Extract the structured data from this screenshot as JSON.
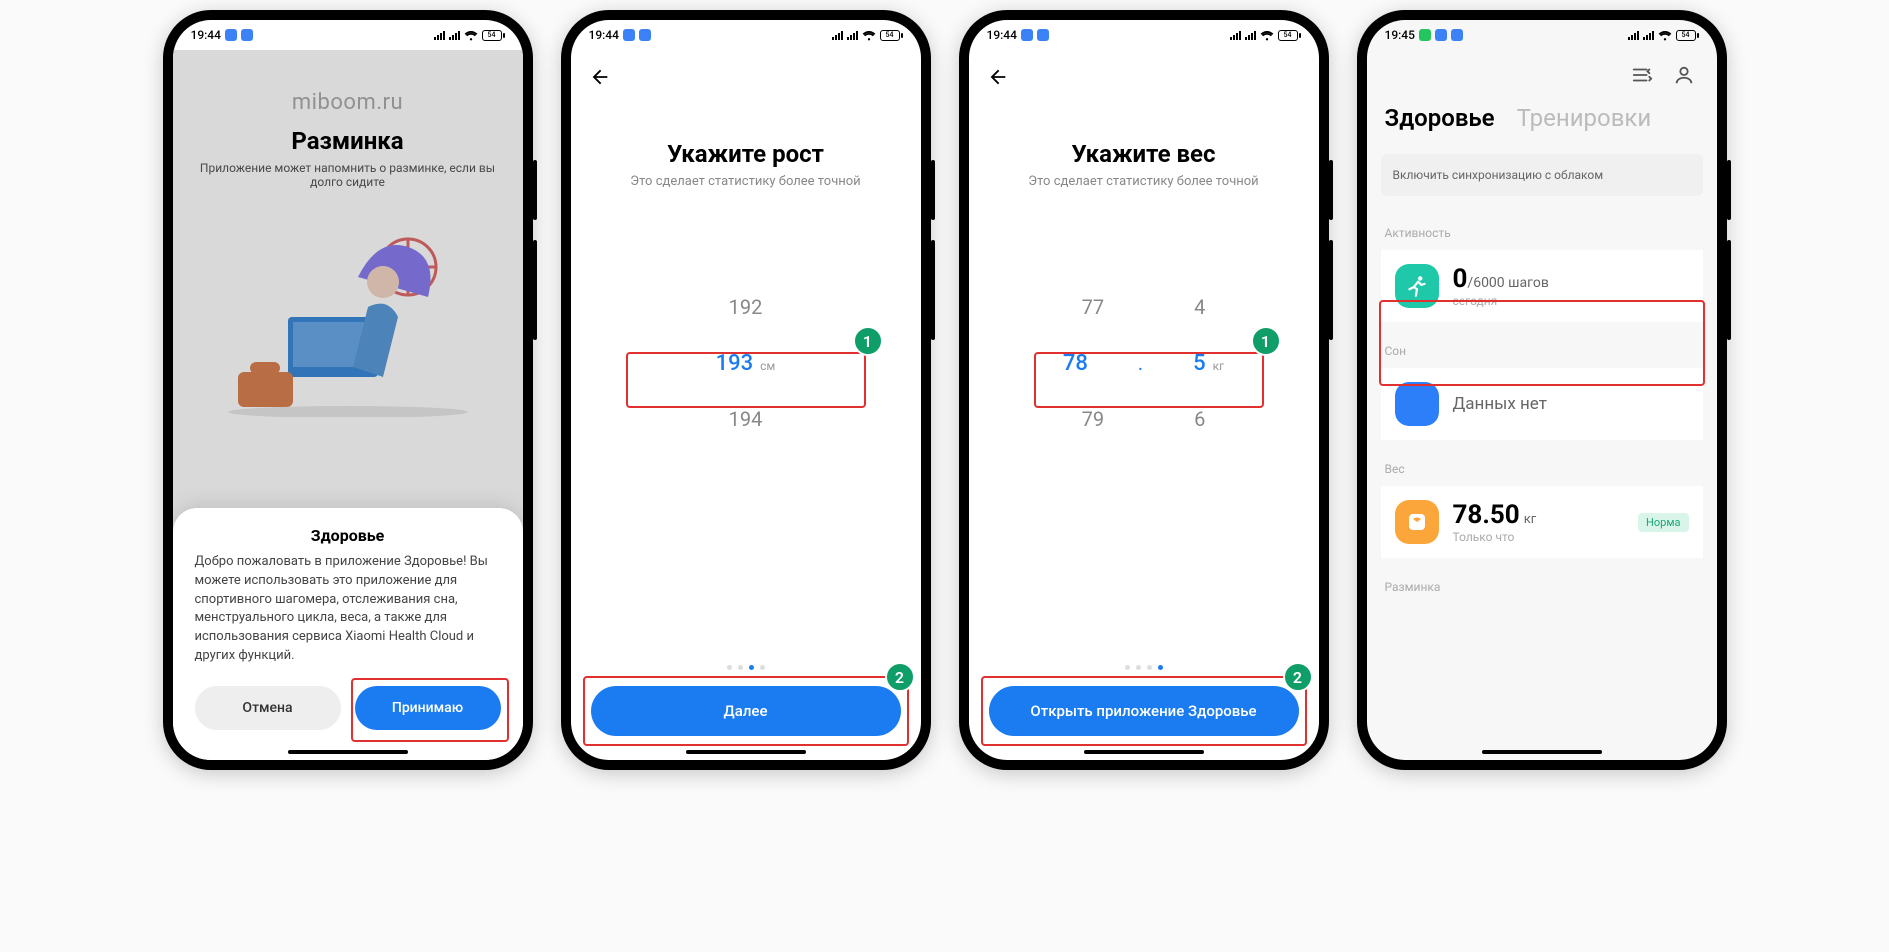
{
  "status": {
    "time1": "19:44",
    "time2": "19:45",
    "battery": "54"
  },
  "screen1": {
    "watermark": "miboom.ru",
    "title": "Разминка",
    "subtitle": "Приложение может напомнить о разминке, если вы долго сидите",
    "sheet_title": "Здоровье",
    "sheet_body": "Добро пожаловать в приложение Здоровье! Вы можете использовать это приложение для спортивного шагомера, отслеживания сна, менструального цикла, веса, а также для использования сервиса Xiaomi Health Cloud и других функций.",
    "cancel": "Отмена",
    "accept": "Принимаю"
  },
  "screen2": {
    "title": "Укажите рост",
    "subtitle": "Это сделает статистику более точной",
    "prev": "192",
    "value": "193",
    "unit": "см",
    "next": "194",
    "button": "Далее",
    "badge1": "1",
    "badge2": "2"
  },
  "screen3": {
    "title": "Укажите вес",
    "subtitle": "Это сделает статистику более точной",
    "prev_int": "77",
    "prev_dec": "4",
    "val_int": "78",
    "val_dec": "5",
    "unit": "кг",
    "next_int": "79",
    "next_dec": "6",
    "button": "Открыть приложение Здоровье",
    "badge1": "1",
    "badge2": "2"
  },
  "screen4": {
    "tab_health": "Здоровье",
    "tab_workout": "Тренировки",
    "cloud_banner": "Включить синхронизацию с облаком",
    "sec_activity": "Активность",
    "steps_value": "0",
    "steps_goal": "/6000 шагов",
    "steps_sub": "сегодня",
    "sec_sleep": "Сон",
    "sleep_text": "Данных нет",
    "sec_weight": "Вес",
    "weight_value": "78.50",
    "weight_unit": "кг",
    "weight_sub": "Только что",
    "weight_badge": "Норма",
    "sec_warmup": "Разминка"
  }
}
